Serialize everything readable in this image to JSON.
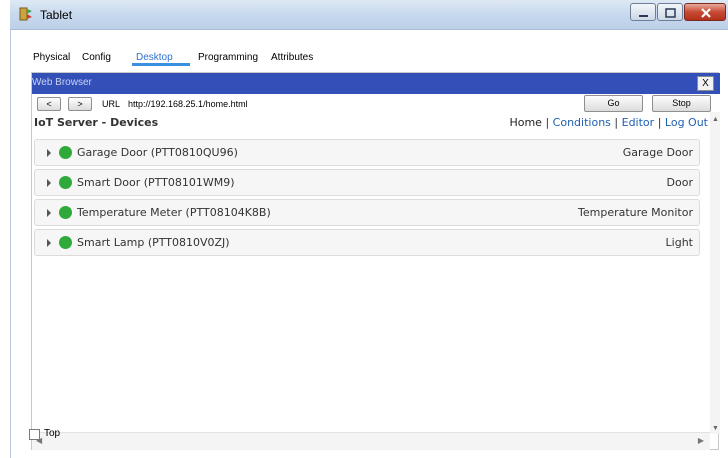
{
  "window": {
    "title": "Tablet"
  },
  "tabs": [
    {
      "label": "Physical",
      "active": false
    },
    {
      "label": "Config",
      "active": false
    },
    {
      "label": "Desktop",
      "active": true
    },
    {
      "label": "Programming",
      "active": false
    },
    {
      "label": "Attributes",
      "active": false
    }
  ],
  "browser": {
    "title": "Web Browser",
    "close_label": "X",
    "back_label": "<",
    "forward_label": ">",
    "url_label": "URL",
    "url_value": "http://192.168.25.1/home.html",
    "go_label": "Go",
    "stop_label": "Stop"
  },
  "page": {
    "title": "IoT Server - Devices",
    "nav": {
      "home": "Home",
      "sep": "|",
      "conditions": "Conditions",
      "editor": "Editor",
      "logout": "Log Out"
    }
  },
  "devices": [
    {
      "name": "Garage Door (PTT0810QU96)",
      "type": "Garage Door",
      "status_color": "#2fa93a"
    },
    {
      "name": "Smart Door (PTT08101WM9)",
      "type": "Door",
      "status_color": "#2fa93a"
    },
    {
      "name": "Temperature Meter (PTT08104K8B)",
      "type": "Temperature Monitor",
      "status_color": "#2fa93a"
    },
    {
      "name": "Smart Lamp (PTT0810V0ZJ)",
      "type": "Light",
      "status_color": "#2fa93a"
    }
  ],
  "footer": {
    "top_label": "Top",
    "top_checked": false
  },
  "colors": {
    "browser_titlebar": "#3350b8",
    "tab_active": "#2f6fd1",
    "link": "#1f5fb0",
    "status_on": "#2fa93a"
  }
}
